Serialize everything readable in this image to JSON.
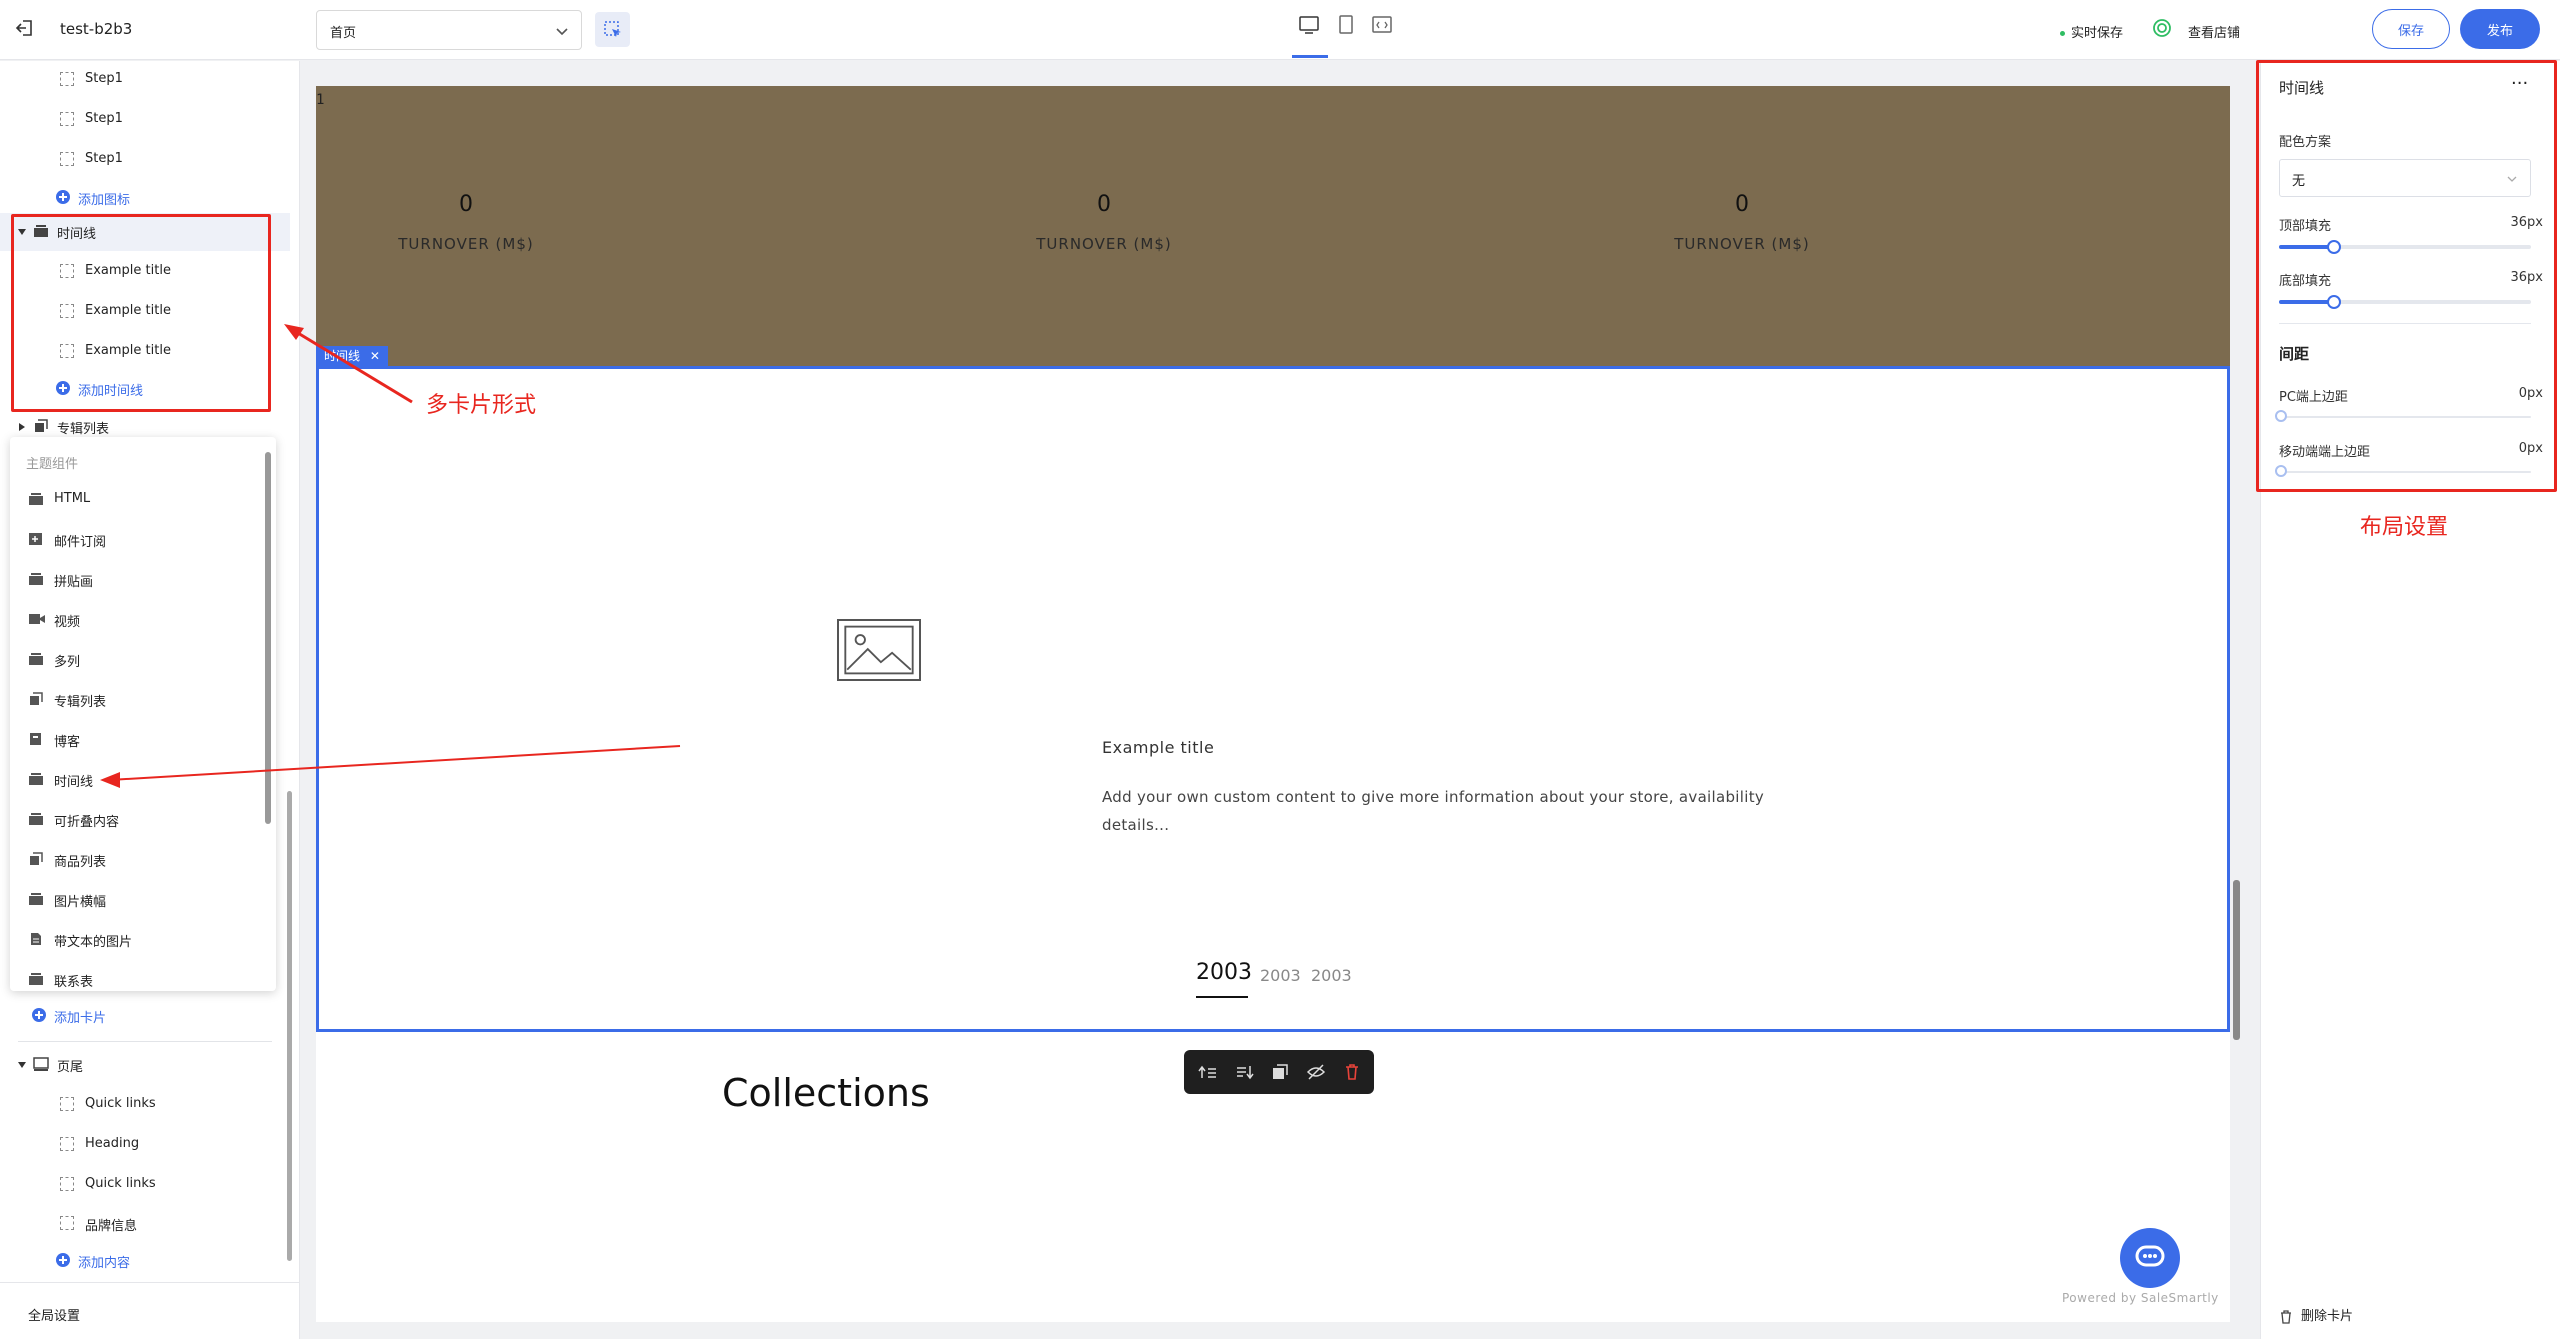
{
  "topbar": {
    "store_name": "test-b2b3",
    "page_select_value": "首页",
    "autosave_label": "实时保存",
    "view_store_label": "查看店铺",
    "save_label": "保存",
    "publish_label": "发布"
  },
  "sidebar": {
    "steps": [
      "Step1",
      "Step1",
      "Step1"
    ],
    "add_icon_label": "添加图标",
    "timeline_label": "时间线",
    "timeline_items": [
      "Example title",
      "Example title",
      "Example title"
    ],
    "add_timeline_label": "添加时间线",
    "album_list_label": "专辑列表",
    "add_card_label": "添加卡片",
    "footer_label": "页尾",
    "footer_items": [
      "Quick links",
      "Heading",
      "Quick links",
      "品牌信息"
    ],
    "add_content_label": "添加内容",
    "global_settings_label": "全局设置"
  },
  "popup": {
    "title": "主题组件",
    "items": [
      "HTML",
      "邮件订阅",
      "拼贴画",
      "视频",
      "多列",
      "专辑列表",
      "博客",
      "时间线",
      "可折叠内容",
      "商品列表",
      "图片横幅",
      "带文本的图片",
      "联系表"
    ]
  },
  "canvas": {
    "index_marker": "1",
    "stats": [
      {
        "num": "0",
        "caption": "TURNOVER (M$)"
      },
      {
        "num": "0",
        "caption": "TURNOVER (M$)"
      },
      {
        "num": "0",
        "caption": "TURNOVER (M$)"
      }
    ],
    "section_tag": "时间线",
    "timeline_title": "Example title",
    "timeline_body": "Add your own custom content to give more information about your store, availability details...",
    "years": [
      "2003",
      "2003",
      "2003"
    ],
    "collections_heading": "Collections",
    "powered_by": "Powered by SaleSmartly"
  },
  "rpanel": {
    "title": "时间线",
    "more": "···",
    "color_scheme_label": "配色方案",
    "color_scheme_value": "无",
    "top_padding_label": "顶部填充",
    "top_padding_value": "36px",
    "top_padding_fill": 0.22,
    "bottom_padding_label": "底部填充",
    "bottom_padding_value": "36px",
    "bottom_padding_fill": 0.22,
    "spacing_section": "间距",
    "pc_margin_label": "PC端上边距",
    "pc_margin_value": "0px",
    "mobile_margin_label": "移动端端上边距",
    "mobile_margin_value": "0px",
    "delete_card_label": "删除卡片"
  },
  "annotations": {
    "multi_card": "多卡片形式",
    "layout_settings": "布局设置"
  },
  "colors": {
    "accent": "#3b6ce8",
    "stats_band": "#7c6b4f",
    "annotation": "#e8261f"
  }
}
